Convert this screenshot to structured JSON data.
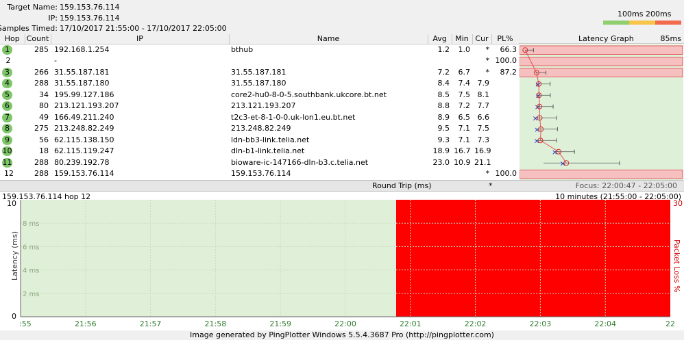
{
  "header": {
    "target_label": "Target Name:",
    "target_value": "159.153.76.114",
    "ip_label": "IP:",
    "ip_value": "159.153.76.114",
    "samples_label": "Samples Timed:",
    "samples_value": "17/10/2017 21:55:00 - 17/10/2017 22:05:00",
    "scale_100": "100ms",
    "scale_200": "200ms",
    "scale_colors": [
      "#8fcf6f",
      "#f7c548",
      "#f26b4e"
    ]
  },
  "table": {
    "columns": [
      "Hop",
      "Count",
      "IP",
      "Name",
      "Avg",
      "Min",
      "Cur",
      "PL%"
    ],
    "latency_graph_label": "Latency Graph",
    "latency_graph_max": "85ms",
    "rows": [
      {
        "hop": "1",
        "count": "285",
        "ip": "192.168.1.254",
        "name": "bthub",
        "avg": "1.2",
        "min": "1.0",
        "cur": "*",
        "pl": "66.3",
        "highlight": true
      },
      {
        "hop": "2",
        "count": "",
        "ip": "-",
        "name": "",
        "avg": "",
        "min": "",
        "cur": "*",
        "pl": "100.0",
        "highlight": false
      },
      {
        "hop": "3",
        "count": "266",
        "ip": "31.55.187.181",
        "name": "31.55.187.181",
        "avg": "7.2",
        "min": "6.7",
        "cur": "*",
        "pl": "87.2",
        "highlight": true
      },
      {
        "hop": "4",
        "count": "288",
        "ip": "31.55.187.180",
        "name": "31.55.187.180",
        "avg": "8.4",
        "min": "7.4",
        "cur": "7.9",
        "pl": "",
        "highlight": true
      },
      {
        "hop": "5",
        "count": "34",
        "ip": "195.99.127.186",
        "name": "core2-hu0-8-0-5.southbank.ukcore.bt.net",
        "avg": "8.5",
        "min": "7.5",
        "cur": "8.1",
        "pl": "",
        "highlight": true
      },
      {
        "hop": "6",
        "count": "80",
        "ip": "213.121.193.207",
        "name": "213.121.193.207",
        "avg": "8.8",
        "min": "7.2",
        "cur": "7.7",
        "pl": "",
        "highlight": true
      },
      {
        "hop": "7",
        "count": "49",
        "ip": "166.49.211.240",
        "name": "t2c3-et-8-1-0-0.uk-lon1.eu.bt.net",
        "avg": "8.9",
        "min": "6.5",
        "cur": "6.6",
        "pl": "",
        "highlight": true
      },
      {
        "hop": "8",
        "count": "275",
        "ip": "213.248.82.249",
        "name": "213.248.82.249",
        "avg": "9.5",
        "min": "7.1",
        "cur": "7.5",
        "pl": "",
        "highlight": true
      },
      {
        "hop": "9",
        "count": "56",
        "ip": "62.115.138.150",
        "name": "ldn-bb3-link.telia.net",
        "avg": "9.3",
        "min": "7.1",
        "cur": "7.3",
        "pl": "",
        "highlight": true
      },
      {
        "hop": "10",
        "count": "18",
        "ip": "62.115.119.247",
        "name": "dln-b1-link.telia.net",
        "avg": "18.9",
        "min": "16.7",
        "cur": "16.9",
        "pl": "",
        "highlight": true
      },
      {
        "hop": "11",
        "count": "288",
        "ip": "80.239.192.78",
        "name": "bioware-ic-147166-dln-b3.c.telia.net",
        "avg": "23.0",
        "min": "10.9",
        "cur": "21.1",
        "pl": "",
        "highlight": true
      },
      {
        "hop": "12",
        "count": "288",
        "ip": "159.153.76.114",
        "name": "159.153.76.114",
        "avg": "",
        "min": "",
        "cur": "*",
        "pl": "100.0",
        "highlight": false
      }
    ]
  },
  "roundtrip": {
    "label": "Round Trip (ms)",
    "cur": "*",
    "focus": "Focus: 22:00:47 - 22:05:00"
  },
  "graph": {
    "title_left": "159.153.76.114 hop 12",
    "title_right": "10 minutes (21:55:00 - 22:05:00)",
    "y_label": "Latency (ms)",
    "y2_label": "Packet Loss %",
    "y_top": "10",
    "y_bottom": "0",
    "y2_top": "30",
    "y_ticks": [
      "8 ms",
      "6 ms",
      "4 ms",
      "2 ms"
    ],
    "x_ticks": [
      ":55",
      "21:56",
      "21:57",
      "21:58",
      "21:59",
      "22:00",
      "22:01",
      "22:02",
      "22:03",
      "22:04",
      "22"
    ],
    "green_bg": "#e0efd8",
    "loss_color": "#ff0000"
  },
  "footer": {
    "text": "Image generated by PingPlotter Windows 5.5.4.3687 Pro (http://pingplotter.com)"
  }
}
